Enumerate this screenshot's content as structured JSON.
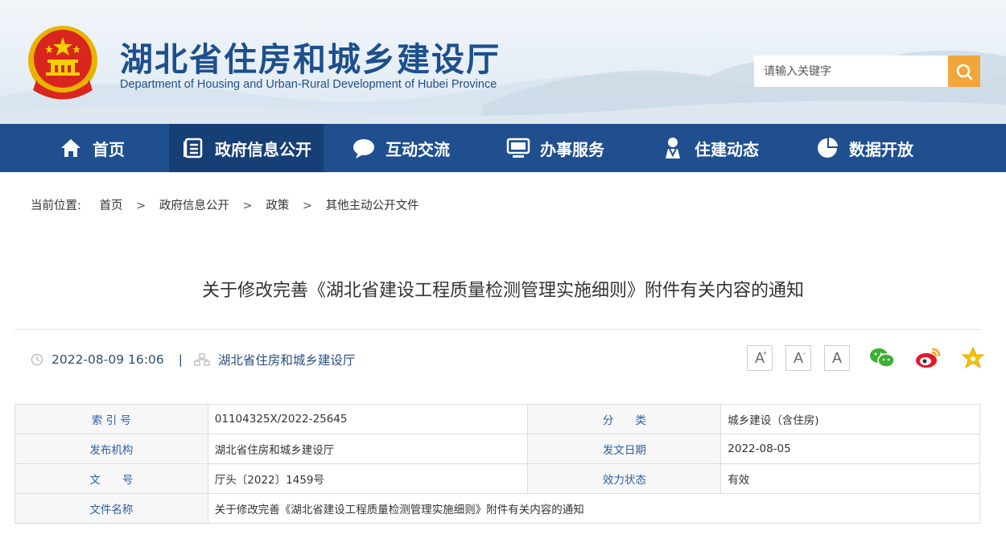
{
  "header": {
    "title": "湖北省住房和城乡建设厅",
    "subtitle": "Department of Housing and Urban-Rural Development of Hubei Province",
    "emblem_icon": "national-emblem-icon"
  },
  "search": {
    "placeholder": "请输入关键字",
    "icon": "search-icon"
  },
  "nav": {
    "items": [
      {
        "label": "首页",
        "icon": "home-icon"
      },
      {
        "label": "政府信息公开",
        "icon": "document-list-icon",
        "active": true
      },
      {
        "label": "互动交流",
        "icon": "chat-bubble-icon"
      },
      {
        "label": "办事服务",
        "icon": "monitor-icon"
      },
      {
        "label": "住建动态",
        "icon": "person-icon"
      },
      {
        "label": "数据开放",
        "icon": "pie-chart-icon"
      }
    ]
  },
  "breadcrumb": {
    "label": "当前位置:",
    "items": [
      "首页",
      "政府信息公开",
      "政策",
      "其他主动公开文件"
    ],
    "separator": ">"
  },
  "article": {
    "title": "关于修改完善《湖北省建设工程质量检测管理实施细则》附件有关内容的通知",
    "datetime": "2022-08-09 16:06",
    "meta_separator": "|",
    "source": "湖北省住房和城乡建设厅"
  },
  "tools": {
    "font_large": "A",
    "font_large_mark": "+",
    "font_small": "A",
    "font_small_mark": "-",
    "font_reset": "A"
  },
  "info_table": {
    "rows": [
      {
        "k1": "索 引 号",
        "v1": "01104325X/2022-25645",
        "k2": "分　　类",
        "v2": "城乡建设（含住房)"
      },
      {
        "k1": "发布机构",
        "v1": "湖北省住房和城乡建设厅",
        "k2": "发文日期",
        "v2": "2022-08-05"
      },
      {
        "k1": "文　　号",
        "v1": "厅头〔2022〕1459号",
        "k2": "效力状态",
        "v2": "有效"
      },
      {
        "k1": "文件名称",
        "v1": "关于修改完善《湖北省建设工程质量检测管理实施细则》附件有关内容的通知"
      }
    ]
  },
  "colors": {
    "nav_bg": "#1f4f8f",
    "nav_active": "#163f76",
    "title_blue": "#1d4f8c",
    "search_button": "#f2a53b"
  }
}
